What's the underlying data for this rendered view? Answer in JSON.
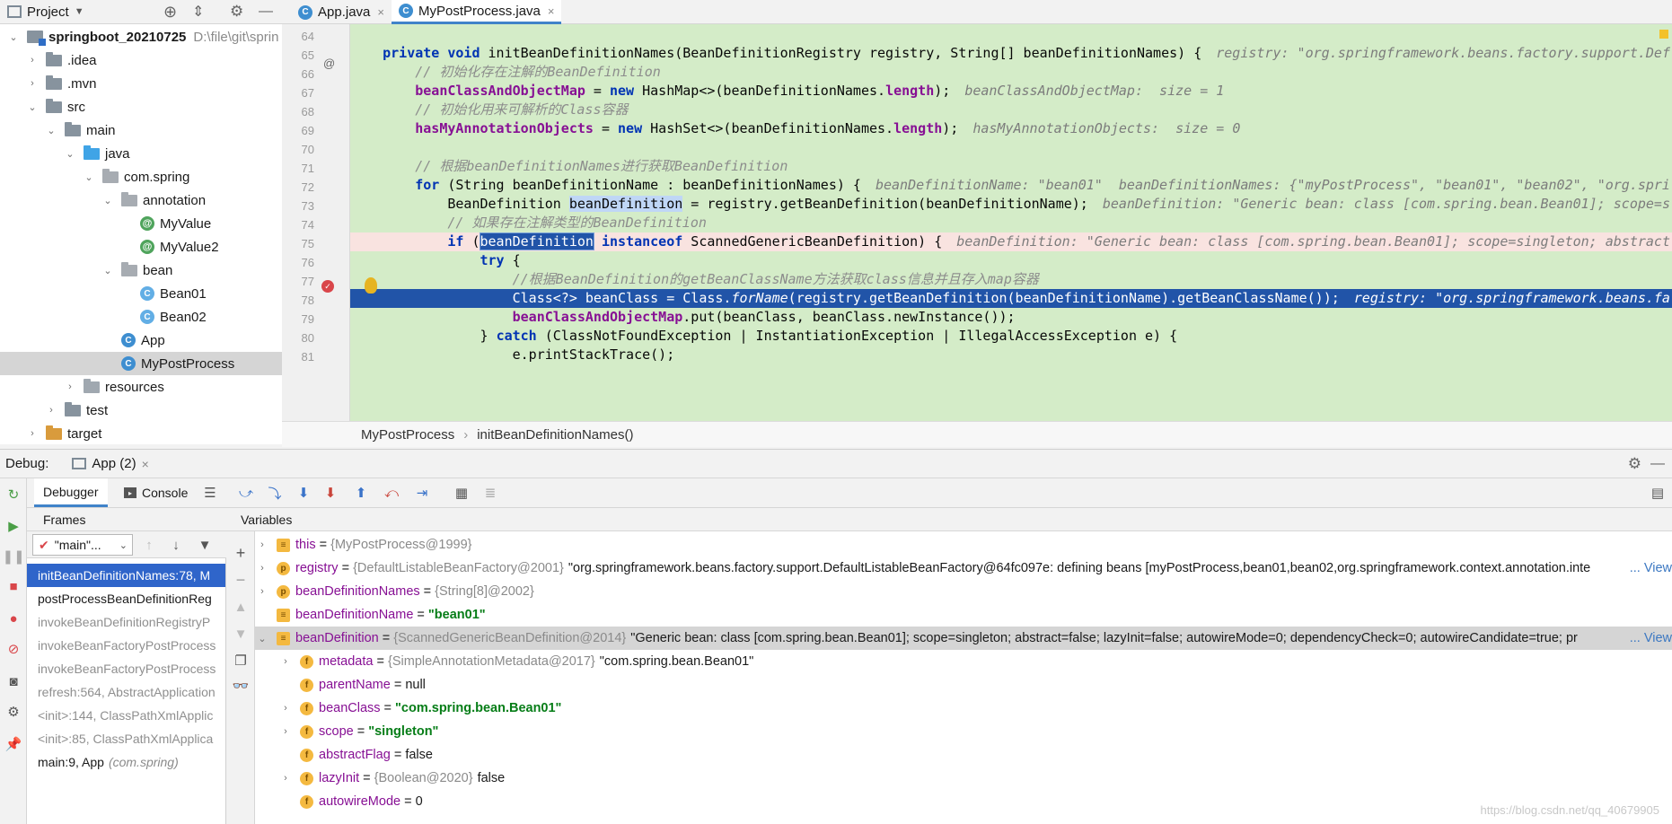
{
  "project": {
    "title": "Project",
    "tree": [
      {
        "label": "springboot_20210725",
        "path": "D:\\file\\git\\sprin",
        "depth": 0,
        "icon": "module",
        "expanded": true
      },
      {
        "label": ".idea",
        "depth": 1,
        "icon": "folder",
        "expanded": false
      },
      {
        "label": ".mvn",
        "depth": 1,
        "icon": "folder",
        "expanded": false
      },
      {
        "label": "src",
        "depth": 1,
        "icon": "folder",
        "expanded": true
      },
      {
        "label": "main",
        "depth": 2,
        "icon": "folder",
        "expanded": true
      },
      {
        "label": "java",
        "depth": 3,
        "icon": "folder-blue",
        "expanded": true
      },
      {
        "label": "com.spring",
        "depth": 4,
        "icon": "package",
        "expanded": true
      },
      {
        "label": "annotation",
        "depth": 5,
        "icon": "package",
        "expanded": true
      },
      {
        "label": "MyValue",
        "depth": 6,
        "icon": "annotation"
      },
      {
        "label": "MyValue2",
        "depth": 6,
        "icon": "annotation"
      },
      {
        "label": "bean",
        "depth": 5,
        "icon": "package",
        "expanded": true
      },
      {
        "label": "Bean01",
        "depth": 6,
        "icon": "class-lite"
      },
      {
        "label": "Bean02",
        "depth": 6,
        "icon": "class-lite"
      },
      {
        "label": "App",
        "depth": 5,
        "icon": "class"
      },
      {
        "label": "MyPostProcess",
        "depth": 5,
        "icon": "class",
        "selected": true
      },
      {
        "label": "resources",
        "depth": 3,
        "icon": "folder-res",
        "expanded": false
      },
      {
        "label": "test",
        "depth": 2,
        "icon": "folder",
        "expanded": false
      },
      {
        "label": "target",
        "depth": 1,
        "icon": "folder-orange",
        "expanded": false
      }
    ]
  },
  "editor": {
    "tabs": [
      {
        "label": "App.java",
        "active": false
      },
      {
        "label": "MyPostProcess.java",
        "active": true
      }
    ],
    "lines": [
      {
        "no": "64",
        "text": ""
      },
      {
        "no": "65",
        "code": "    private void initBeanDefinitionNames(BeanDefinitionRegistry registry, String[] beanDefinitionNames) {",
        "hint": "registry: \"org.springframework.beans.factory.support.Def"
      },
      {
        "no": "66",
        "comment": "        // 初始化存在注解的BeanDefinition"
      },
      {
        "no": "67",
        "code": "        beanClassAndObjectMap = new HashMap<>(beanDefinitionNames.length);",
        "hint": "beanClassAndObjectMap:  size = 1"
      },
      {
        "no": "68",
        "comment": "        // 初始化用来可解析的Class容器"
      },
      {
        "no": "69",
        "code": "        hasMyAnnotationObjects = new HashSet<>(beanDefinitionNames.length);",
        "hint": "hasMyAnnotationObjects:  size = 0"
      },
      {
        "no": "70",
        "text": ""
      },
      {
        "no": "71",
        "comment": "        // 根据beanDefinitionNames进行获取BeanDefinition"
      },
      {
        "no": "72",
        "code": "        for (String beanDefinitionName : beanDefinitionNames) {",
        "hint": "beanDefinitionName: \"bean01\"  beanDefinitionNames: {\"myPostProcess\", \"bean01\", \"bean02\", \"org.spri"
      },
      {
        "no": "73",
        "code": "            BeanDefinition beanDefinition = registry.getBeanDefinition(beanDefinitionName);",
        "hint": "beanDefinition: \"Generic bean: class [com.spring.bean.Bean01]; scope=s"
      },
      {
        "no": "74",
        "comment": "            // 如果存在注解类型的BeanDefinition"
      },
      {
        "no": "75",
        "code": "            if (beanDefinition instanceof ScannedGenericBeanDefinition) {",
        "hint": "beanDefinition: \"Generic bean: class [com.spring.bean.Bean01]; scope=singleton; abstract"
      },
      {
        "no": "76",
        "code": "                try {"
      },
      {
        "no": "77",
        "comment": "                    //根据BeanDefinition的getBeanClassName方法获取class信息并且存入map容器"
      },
      {
        "no": "78",
        "code": "                    Class<?> beanClass = Class.forName(registry.getBeanDefinition(beanDefinitionName).getBeanClassName());",
        "hint": "registry: \"org.springframework.beans.fa"
      },
      {
        "no": "79",
        "code": "                    beanClassAndObjectMap.put(beanClass, beanClass.newInstance());"
      },
      {
        "no": "80",
        "code": "                } catch (ClassNotFoundException | InstantiationException | IllegalAccessException e) {"
      },
      {
        "no": "81",
        "code": "                    e.printStackTrace();"
      }
    ],
    "breadcrumb": [
      "MyPostProcess",
      "initBeanDefinitionNames()"
    ]
  },
  "debug": {
    "label": "Debug:",
    "session": "App (2)",
    "tabs": [
      "Debugger",
      "Console"
    ],
    "frames_title": "Frames",
    "thread": "\"main\"...",
    "frames": [
      {
        "text": "initBeanDefinitionNames:78, M",
        "state": "selected"
      },
      {
        "text": "postProcessBeanDefinitionReg",
        "state": "normal"
      },
      {
        "text": "invokeBeanDefinitionRegistryP",
        "state": "dim"
      },
      {
        "text": "invokeBeanFactoryPostProcess",
        "state": "dim"
      },
      {
        "text": "invokeBeanFactoryPostProcess",
        "state": "dim"
      },
      {
        "text": "refresh:564, AbstractApplication",
        "state": "dim"
      },
      {
        "text": "<init>:144, ClassPathXmlApplic",
        "state": "dim"
      },
      {
        "text": "<init>:85, ClassPathXmlApplica",
        "state": "dim"
      },
      {
        "text": "main:9, App",
        "pkg": "(com.spring)",
        "state": "normal"
      }
    ],
    "variables_title": "Variables",
    "variables": [
      {
        "indent": 0,
        "icon": "list",
        "expand": true,
        "name": "this",
        "type": "{MyPostProcess@1999}",
        "value": ""
      },
      {
        "indent": 0,
        "icon": "p",
        "expand": true,
        "name": "registry",
        "type": "{DefaultListableBeanFactory@2001}",
        "value": "\"org.springframework.beans.factory.support.DefaultListableBeanFactory@64fc097e: defining beans [myPostProcess,bean01,bean02,org.springframework.context.annotation.inte",
        "view": "... View"
      },
      {
        "indent": 0,
        "icon": "p",
        "expand": true,
        "name": "beanDefinitionNames",
        "type": "{String[8]@2002}",
        "value": ""
      },
      {
        "indent": 0,
        "icon": "list",
        "expand": false,
        "name": "beanDefinitionName",
        "type": "",
        "value": "\"bean01\"",
        "str": true
      },
      {
        "indent": 0,
        "icon": "list",
        "expand": "open",
        "name": "beanDefinition",
        "type": "{ScannedGenericBeanDefinition@2014}",
        "value": "\"Generic bean: class [com.spring.bean.Bean01]; scope=singleton; abstract=false; lazyInit=false; autowireMode=0; dependencyCheck=0; autowireCandidate=true; pr",
        "view": "... View",
        "selected": true
      },
      {
        "indent": 1,
        "icon": "f",
        "expand": true,
        "name": "metadata",
        "type": "{SimpleAnnotationMetadata@2017}",
        "value": "\"com.spring.bean.Bean01\""
      },
      {
        "indent": 1,
        "icon": "f",
        "expand": false,
        "name": "parentName",
        "type": "",
        "value": "null"
      },
      {
        "indent": 1,
        "icon": "f",
        "expand": true,
        "name": "beanClass",
        "type": "",
        "value": "\"com.spring.bean.Bean01\"",
        "str": true
      },
      {
        "indent": 1,
        "icon": "f",
        "expand": true,
        "name": "scope",
        "type": "",
        "value": "\"singleton\"",
        "str": true
      },
      {
        "indent": 1,
        "icon": "f",
        "expand": false,
        "name": "abstractFlag",
        "type": "",
        "value": "false"
      },
      {
        "indent": 1,
        "icon": "f",
        "expand": true,
        "name": "lazyInit",
        "type": "{Boolean@2020}",
        "value": "false"
      },
      {
        "indent": 1,
        "icon": "f",
        "expand": false,
        "name": "autowireMode",
        "type": "",
        "value": "0"
      }
    ]
  },
  "watermark": "https://blog.csdn.net/qq_40679905",
  "colors": {
    "code_bg": "#d4ecc8",
    "exec_line": "#2154a8",
    "breakpoint_line": "#f9e3e0",
    "accent": "#2f65ca"
  }
}
